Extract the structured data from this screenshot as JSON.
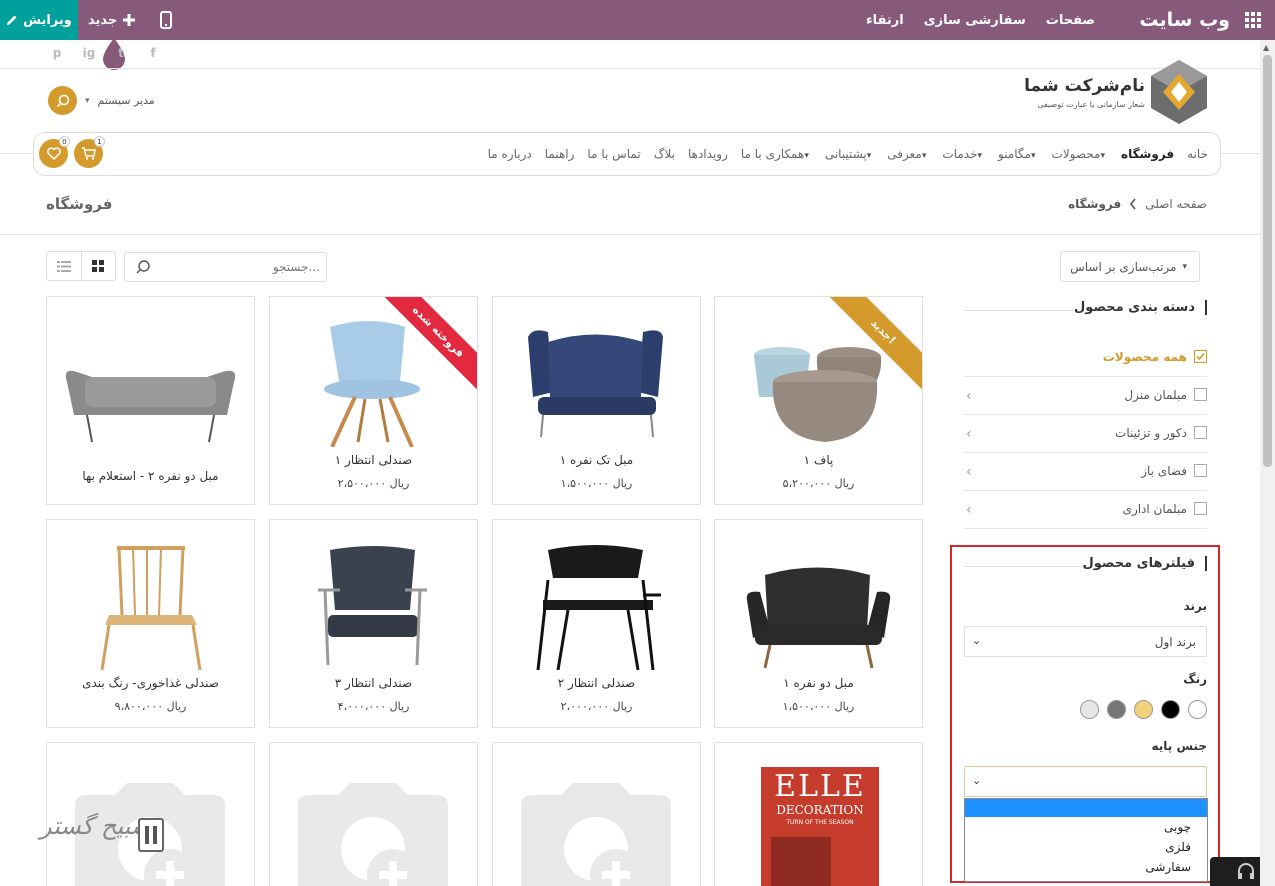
{
  "topbar": {
    "edit_label": "ویرایش",
    "new_label": "جدید",
    "menu": [
      "صفحات",
      "سفارشی سازی",
      "ارتقاء"
    ],
    "brand": "وب سایت"
  },
  "social": [
    "f",
    "t",
    "ig",
    "p"
  ],
  "header": {
    "company_name": "نام‌شرکت شما",
    "slogan": "شعار سازمانی یا عبارت توصیفی",
    "user_name": "مدیر سیستم"
  },
  "nav": {
    "items": [
      "خانه",
      "فروشگاه",
      "محصولات",
      "مگامنو",
      "خدمات",
      "معرفی",
      "پشتیبانی",
      "همکاری با ما",
      "رویدادها",
      "بلاگ",
      "تماس با ما",
      "راهنما",
      "درباره ما"
    ],
    "cart_count": "1",
    "wishlist_count": "0"
  },
  "breadcrumb": {
    "home": "صفحه اصلی",
    "current": "فروشگاه",
    "page_title": "فروشگاه"
  },
  "toolbar": {
    "sort_label": "مرتب‌سازی بر اساس",
    "search_placeholder": "جستجو..."
  },
  "products": [
    {
      "name": "پاف ۱",
      "price": "۵،۲۰۰،۰۰۰ ریال",
      "ribbon": "جدید!",
      "ribbon_color": "#d59a2c"
    },
    {
      "name": "مبل تک نفره ۱",
      "price": "۱،۵۰۰،۰۰۰ ریال",
      "ribbon": "",
      "ribbon_color": ""
    },
    {
      "name": "صندلی انتظار ۱",
      "price": "۲،۵۰۰،۰۰۰ ریال",
      "ribbon": "فروخته شده",
      "ribbon_color": "#e2293f"
    },
    {
      "name": "مبل دو نفره ۲ - استعلام بها",
      "price": "",
      "ribbon": "",
      "ribbon_color": ""
    },
    {
      "name": "مبل دو نفره ۱",
      "price": "۱،۵۰۰،۰۰۰ ریال",
      "ribbon": "",
      "ribbon_color": ""
    },
    {
      "name": "صندلی انتظار ۲",
      "price": "۲،۰۰۰،۰۰۰ ریال",
      "ribbon": "",
      "ribbon_color": ""
    },
    {
      "name": "صندلی انتظار ۳",
      "price": "۴،۰۰۰،۰۰۰ ریال",
      "ribbon": "",
      "ribbon_color": ""
    },
    {
      "name": "صندلی غذاخوری- رنگ بندی",
      "price": "۹،۸۰۰،۰۰۰ ریال",
      "ribbon": "",
      "ribbon_color": ""
    }
  ],
  "magazine": {
    "title": "ELLE",
    "subtitle": "DECORATION",
    "tagline": "TURN OF THE SEASON"
  },
  "sidebar": {
    "categories_title": "دسته بندی محصول",
    "categories": [
      {
        "label": "همه محصولات",
        "checked": true
      },
      {
        "label": "مبلمان منزل",
        "checked": false
      },
      {
        "label": "دکور و تزئینات",
        "checked": false
      },
      {
        "label": "فضای باز",
        "checked": false
      },
      {
        "label": "مبلمان اداری",
        "checked": false
      }
    ],
    "filters_title": "فیلترهای محصول",
    "brand_label": "برند",
    "brand_value": "برند اول",
    "color_label": "رنگ",
    "colors": [
      "#ffffff",
      "#000000",
      "#f0d27a",
      "#777777",
      "#e6e6e6"
    ],
    "base_label": "جنس پایه",
    "base_options": [
      "",
      "چوبی",
      "فلزی",
      "سفارشی"
    ]
  },
  "watermark": "تسبیح گستر",
  "colors": {
    "topbar": "#875a7b",
    "edit": "#00a09d",
    "accent": "#d59a2c",
    "highlight": "#d6262d"
  }
}
